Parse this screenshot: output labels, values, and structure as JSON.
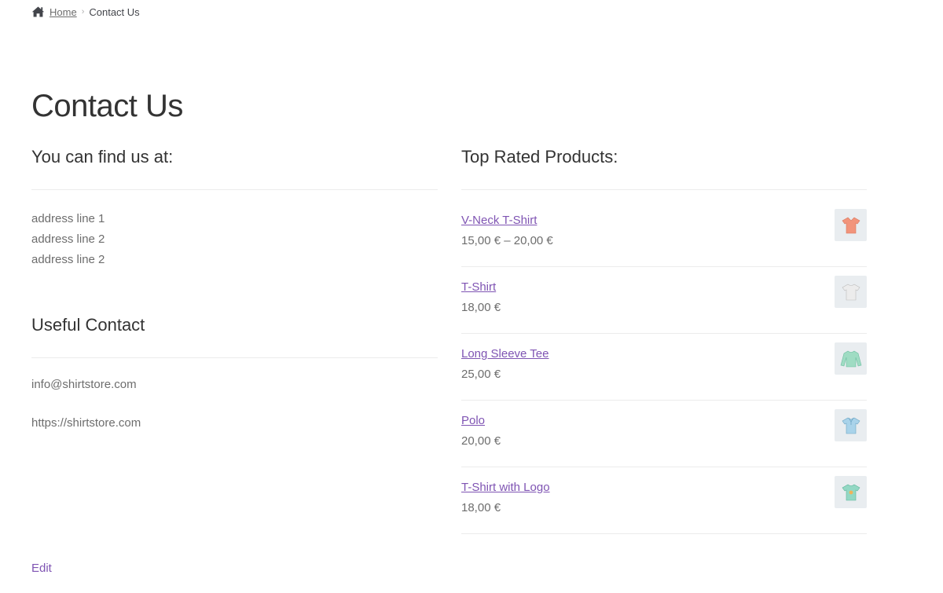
{
  "breadcrumb": {
    "home_label": "Home",
    "current": "Contact Us",
    "home_icon": "home-icon"
  },
  "page": {
    "title": "Contact Us",
    "edit_label": "Edit"
  },
  "find_us": {
    "title": "You can find us at:",
    "address_lines": [
      "address line 1",
      "address line 2",
      "address line 2"
    ]
  },
  "useful_contact": {
    "title": "Useful Contact",
    "email": "info@shirtstore.com",
    "website": "https://shirtstore.com"
  },
  "top_rated": {
    "title": "Top Rated Products:",
    "products": [
      {
        "name": "V-Neck T-Shirt",
        "price": "15,00 € – 20,00 €",
        "icon": "vneck-tshirt-icon",
        "color": "#f2947b"
      },
      {
        "name": "T-Shirt",
        "price": "18,00 €",
        "icon": "tshirt-icon",
        "color": "#e6e6e6"
      },
      {
        "name": "Long Sleeve Tee",
        "price": "25,00 €",
        "icon": "long-sleeve-tee-icon",
        "color": "#9fdcc3"
      },
      {
        "name": "Polo",
        "price": "20,00 €",
        "icon": "polo-icon",
        "color": "#a9d3ea"
      },
      {
        "name": "T-Shirt with Logo",
        "price": "18,00 €",
        "icon": "tshirt-logo-icon",
        "color": "#93d8c4"
      }
    ]
  },
  "colors": {
    "link": "#7f54b3",
    "text": "#6d6d6d",
    "heading": "#333333",
    "divider": "#ececec"
  }
}
